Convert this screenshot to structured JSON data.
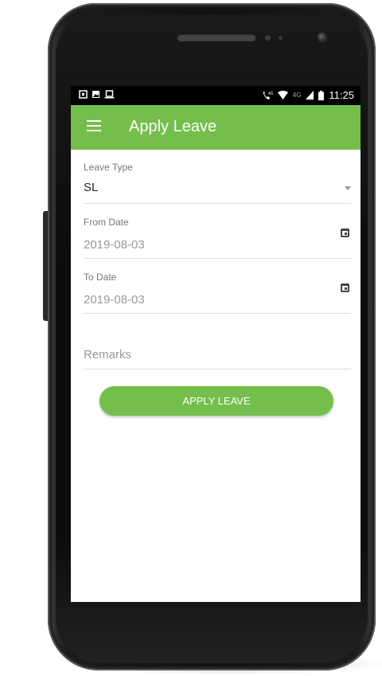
{
  "status_bar": {
    "time": "11:25",
    "network": "4G"
  },
  "app_bar": {
    "title": "Apply Leave"
  },
  "form": {
    "leave_type": {
      "label": "Leave Type",
      "value": "SL"
    },
    "from_date": {
      "label": "From Date",
      "value": "2019-08-03"
    },
    "to_date": {
      "label": "To Date",
      "value": "2019-08-03"
    },
    "remarks": {
      "placeholder": "Remarks",
      "value": ""
    }
  },
  "actions": {
    "apply_label": "APPLY LEAVE"
  },
  "colors": {
    "primary": "#74bf4b",
    "status_bar": "#000000"
  }
}
